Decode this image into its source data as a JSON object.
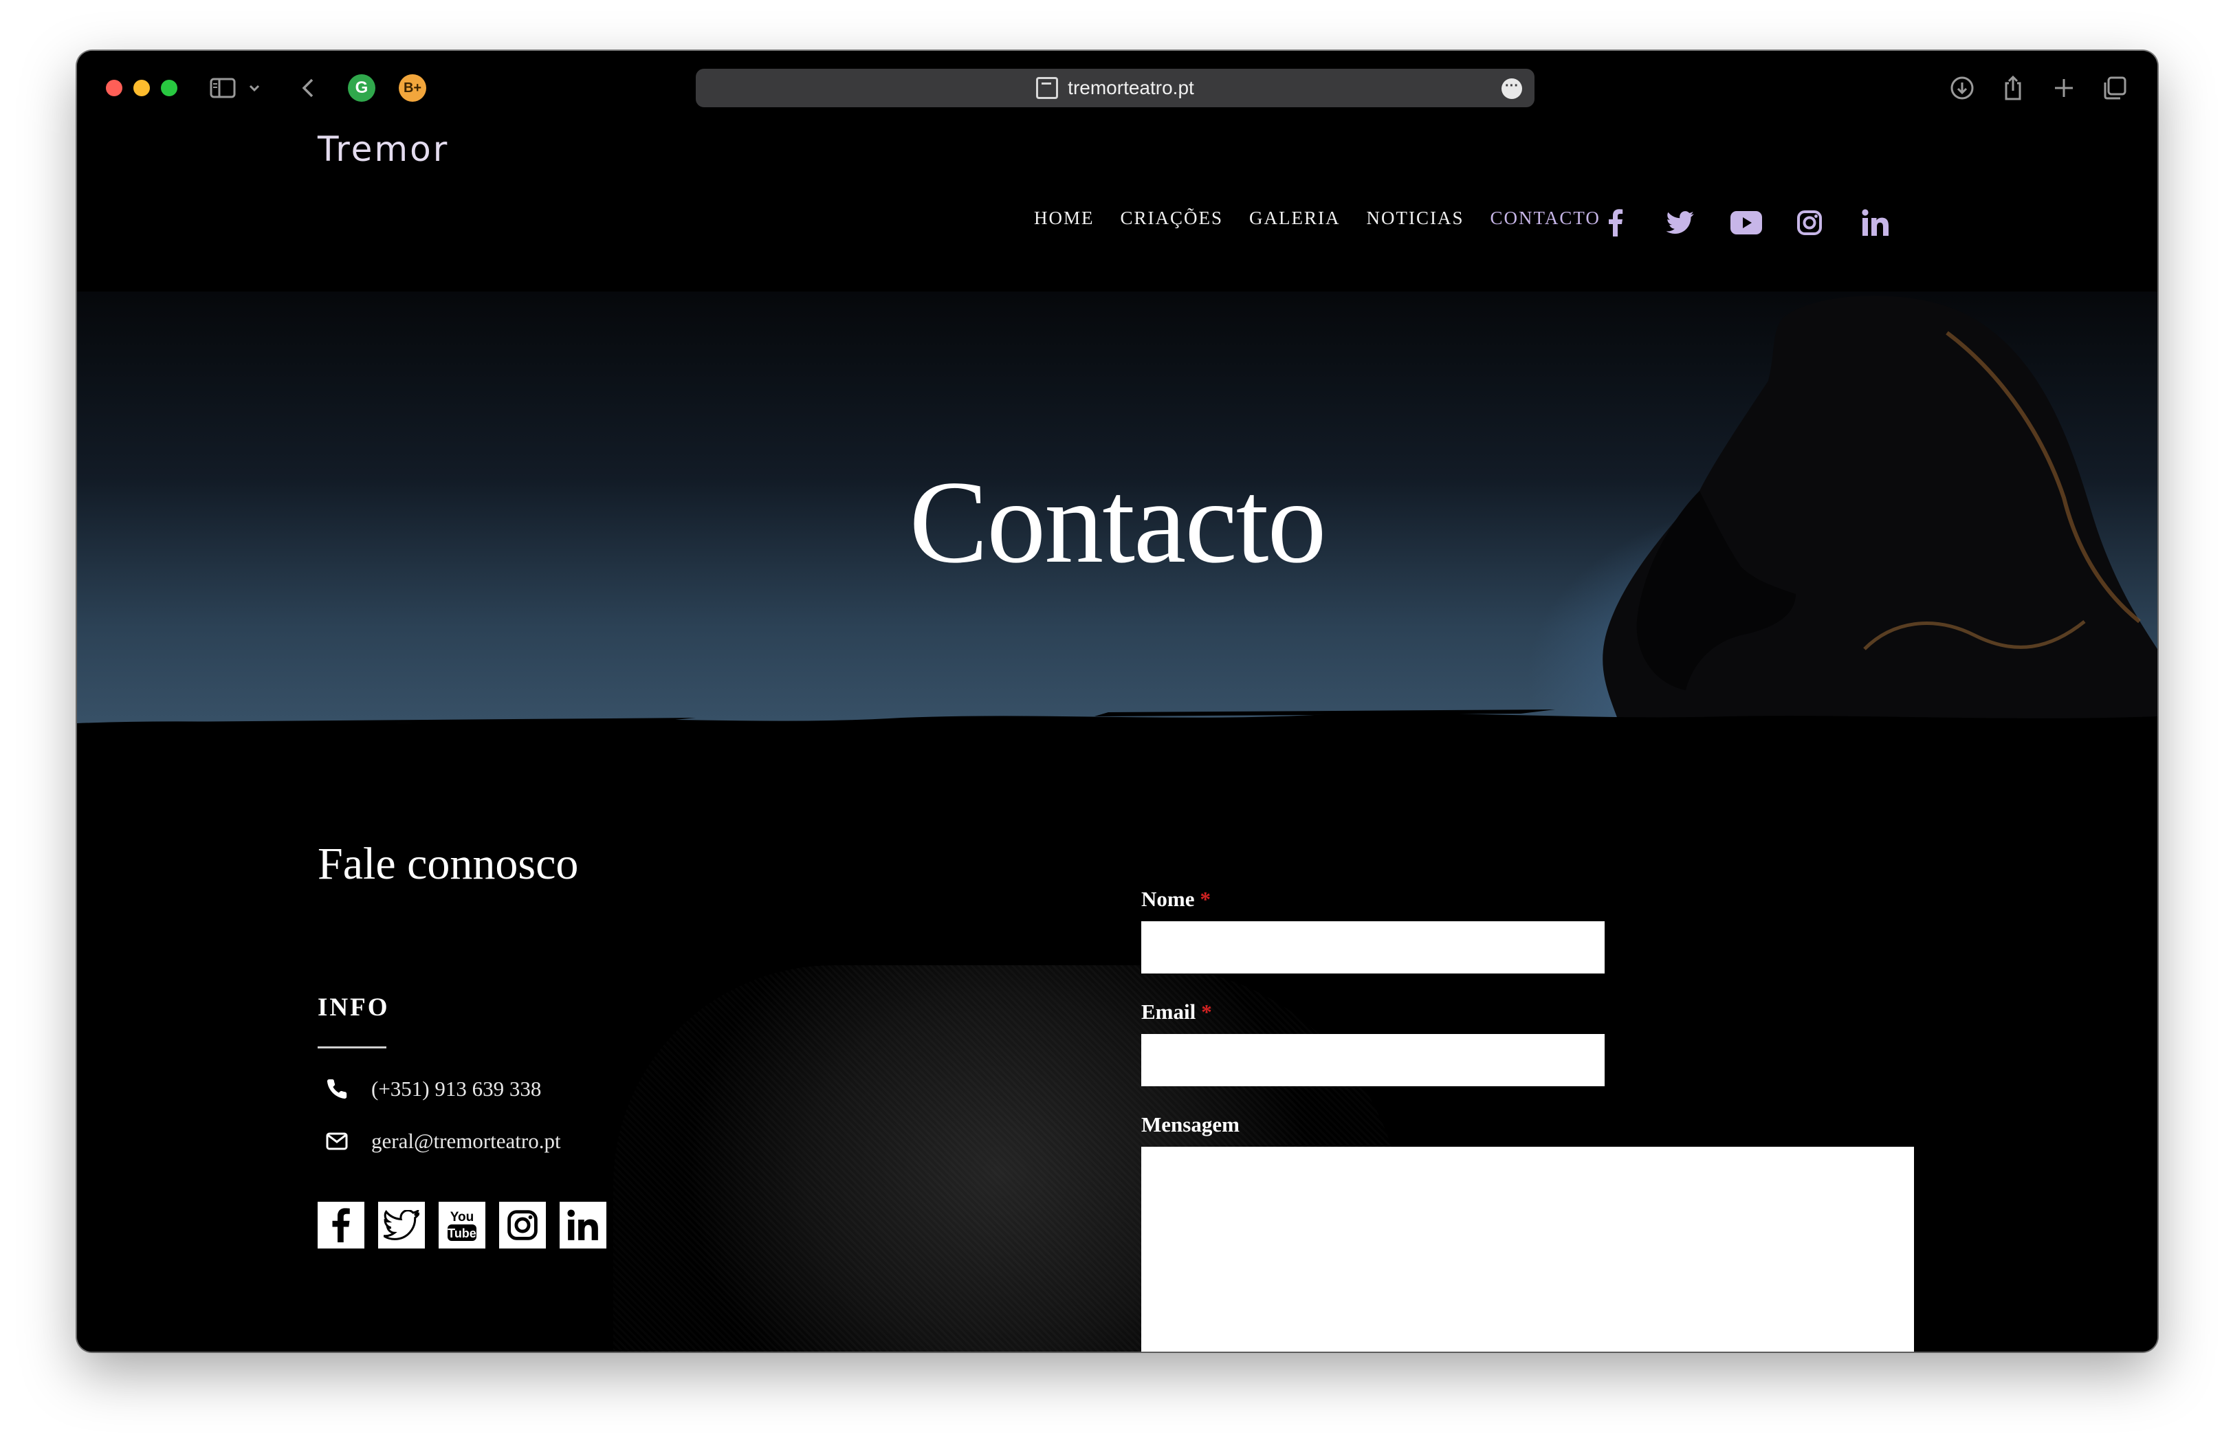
{
  "browser": {
    "url": "tremorteatro.pt"
  },
  "site": {
    "logo_text": "Tremor",
    "nav": [
      {
        "label": "HOME"
      },
      {
        "label": "CRIAÇÕES"
      },
      {
        "label": "GALERIA"
      },
      {
        "label": "NOTICIAS"
      },
      {
        "label": "CONTACTO",
        "active": true
      }
    ],
    "nav_social": [
      "facebook-icon",
      "twitter-icon",
      "youtube-icon",
      "instagram-icon",
      "linkedin-icon"
    ],
    "accent_color": "#c7b6e8"
  },
  "hero": {
    "title": "Contacto"
  },
  "contact": {
    "heading": "Fale connosco",
    "info_heading": "INFO",
    "phone": "(+351) 913 639 338",
    "email": "geral@tremorteatro.pt",
    "social": [
      "facebook-icon",
      "twitter-icon",
      "youtube-icon",
      "instagram-icon",
      "linkedin-icon"
    ]
  },
  "form": {
    "name_label": "Nome",
    "email_label": "Email",
    "message_label": "Mensagem",
    "required_mark": "*",
    "name_value": "",
    "email_value": "",
    "message_value": ""
  }
}
